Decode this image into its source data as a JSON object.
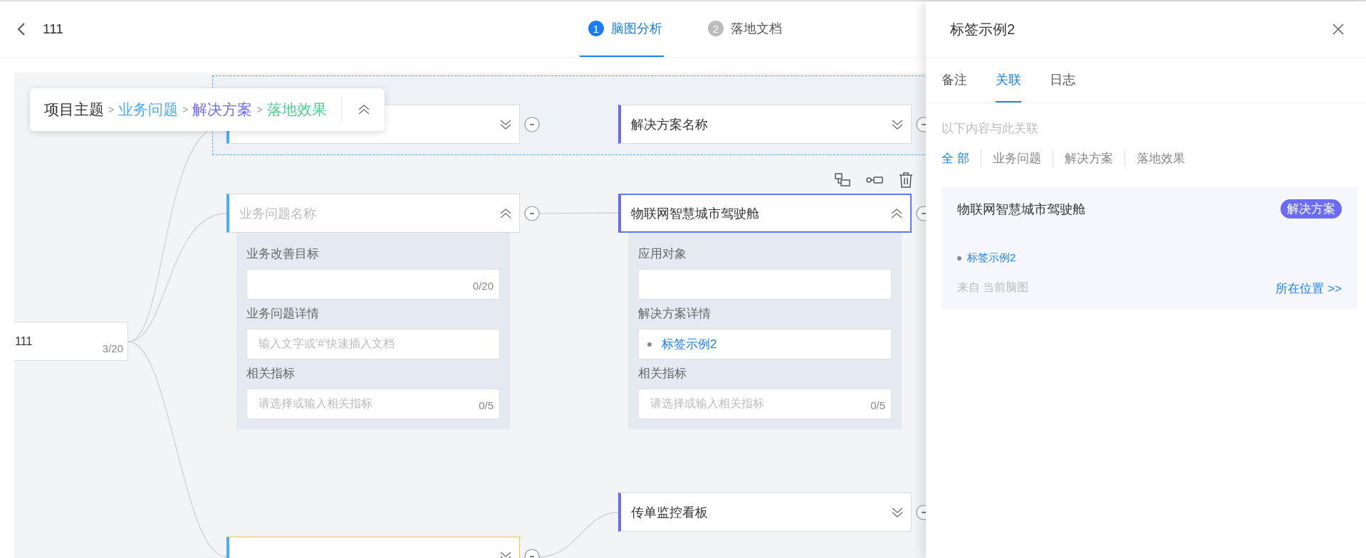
{
  "header": {
    "title": "111",
    "steps": [
      {
        "number": "1",
        "label": "脑图分析",
        "selected": true
      },
      {
        "number": "2",
        "label": "落地文档",
        "selected": false
      }
    ]
  },
  "breadcrumb": {
    "items": [
      {
        "label": "项目主题",
        "color": "#333333"
      },
      {
        "separator": ">",
        "label": "业务问题",
        "color": "#4aa8f5"
      },
      {
        "separator": ">",
        "label": "解决方案",
        "color": "#6b6cf6"
      },
      {
        "separator": ">",
        "label": "落地效果",
        "color": "#4ccf8c"
      }
    ],
    "expanded": true
  },
  "mindmap": {
    "root": {
      "title": "111",
      "count": "3/20"
    },
    "nodes": [
      {
        "kind": "problem",
        "expanded": false,
        "selected": false,
        "highlighted": false
      },
      {
        "kind": "solution",
        "title": "解决方案名称",
        "expanded": false,
        "selected": false,
        "highlighted": false
      },
      {
        "kind": "problem",
        "placeholder": "业务问题名称",
        "expanded": true,
        "selected": false,
        "highlighted": false,
        "fields": [
          {
            "label": "业务改善目标",
            "count": "0/20"
          },
          {
            "label": "业务问题详情",
            "placeholder": "输入文字或'#'快速插入文档"
          },
          {
            "label": "相关指标",
            "placeholder": "请选择或输入相关指标",
            "count": "0/5"
          }
        ]
      },
      {
        "kind": "solution",
        "title": "物联网智慧城市驾驶舱",
        "expanded": true,
        "selected": true,
        "highlighted": false,
        "fields": [
          {
            "label": "应用对象"
          },
          {
            "label": "解决方案详情",
            "items": [
              "标签示例2"
            ]
          },
          {
            "label": "相关指标",
            "placeholder": "请选择或输入相关指标",
            "count": "0/5"
          }
        ]
      },
      {
        "kind": "solution",
        "title": "传单监控看板",
        "expanded": false,
        "selected": false,
        "highlighted": false
      },
      {
        "kind": "problem",
        "expanded": false,
        "selected": false,
        "highlighted": true
      }
    ]
  },
  "side_panel": {
    "title": "标签示例2",
    "tabs": [
      {
        "label": "备注",
        "selected": false
      },
      {
        "label": "关联",
        "selected": true
      },
      {
        "label": "日志",
        "selected": false
      }
    ],
    "hint": "以下内容与此关联",
    "filters": [
      {
        "label": "全 部",
        "selected": true
      },
      {
        "label": "业务问题",
        "selected": false
      },
      {
        "label": "解决方案",
        "selected": false
      },
      {
        "label": "落地效果",
        "selected": false
      }
    ],
    "cards": [
      {
        "title": "物联网智慧城市驾驶舱",
        "tag": "解决方案",
        "color": "#6b6cf6",
        "items": [
          "标签示例2"
        ],
        "source": "来自 当前脑图",
        "link": "所在位置 >>"
      }
    ]
  }
}
